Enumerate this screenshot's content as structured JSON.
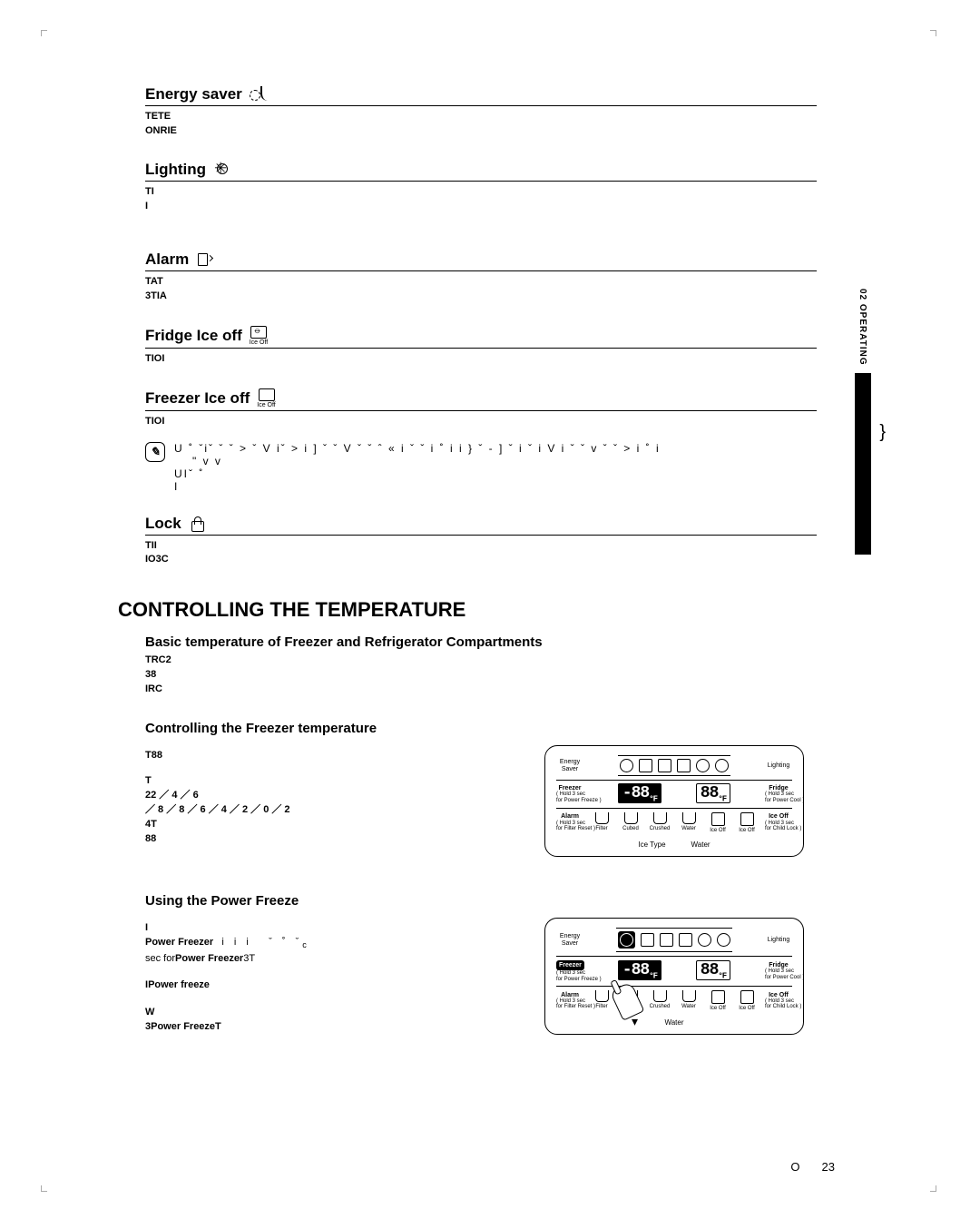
{
  "sidetab": "02 OPERATING",
  "brace": "}",
  "sections": {
    "energy": {
      "title": "Energy saver",
      "l1": "TETE",
      "l2": "ONRIE"
    },
    "lighting": {
      "title": "Lighting",
      "l1": "TI",
      "l2": "I"
    },
    "alarm": {
      "title": "Alarm",
      "l1": "TAT",
      "l2": "3TIA"
    },
    "fridgeice": {
      "title": "Fridge Ice off",
      "cap": "Ice Off",
      "l1": "TIOI"
    },
    "freezerice": {
      "title": "Freezer Ice off",
      "cap": "Ice Off",
      "l1": "TIOI"
    },
    "note1": "U ˚ ˇiˇ    ˇ ˇ   >   ˇ   V iˇ  >   i   ] ˇ    ˇ V      ˇ ˇ ˆ « i   ˇ ˇ     i ˚ i   i  }    ˇ -  ] ˇ  i ˇ  i V      i   ˇ ˇ  v ˇ      ˇ   >  i ˚ i",
    "note2": "\" v v",
    "note3": "UIˇ ˚",
    "note4": "I",
    "lock": {
      "title": "Lock",
      "l1": "TII",
      "l2": "IO3C"
    }
  },
  "h1": "CONTROLLING THE TEMPERATURE",
  "basic": {
    "title": "Basic temperature of Freezer and Refrigerator Compartments",
    "l1": "TRC2",
    "l2": "38",
    "l3": "IRC"
  },
  "freezer": {
    "title": "Controlling the Freezer temperature",
    "l1": "T88",
    "l2": "T",
    "l3": "22 ／ 4 ／ 6",
    "l4": "／ 8 ／ 8 ／ 6 ／ 4 ／ 2 ／ 0 ／ 2",
    "l5": "4T",
    "l6": "88"
  },
  "panel": {
    "energy": "Energy\nSaver",
    "lighting": "Lighting",
    "freezerBtn": "Freezer",
    "freezerSub": "( Hold 3 sec\nfor Power Freeze )",
    "fridgeBtn": "Fridge",
    "fridgeSub": "( Hold 3 sec\nfor Power Cool )",
    "alarmBtn": "Alarm",
    "alarmSub": "( Hold 3 sec\nfor Filter Reset )",
    "iceOffBtn": "Ice Off",
    "iceOffSub": "( Hold 3 sec\nfor Child Lock )",
    "seg1": "-88",
    "unit": "°F",
    "seg2": "88",
    "tiny": {
      "filter": "Filter",
      "cubed": "Cubed",
      "crushed": "Crushed",
      "water": "Water",
      "iceoff1": "Ice Off",
      "iceoff2": "Ice Off"
    },
    "dispIce": "Ice Type",
    "dispWater": "Water"
  },
  "power": {
    "title": "Using the Power Freeze",
    "l1": "I",
    "l2pre": "Power Freezer",
    "l2mid": "i i   i",
    "l2tail": "ˇ  ˚     ˇ",
    "l2c": "c",
    "l3pre": "sec for",
    "l3b": "Power Freezer",
    "l3post": "3T",
    "l4pre": "I",
    "l4b": "Power freeze",
    "l5": "W",
    "l6pre": "3",
    "l6b": "Power Freeze",
    "l6post": "T"
  },
  "footer": {
    "o": "O",
    "page": "23"
  }
}
